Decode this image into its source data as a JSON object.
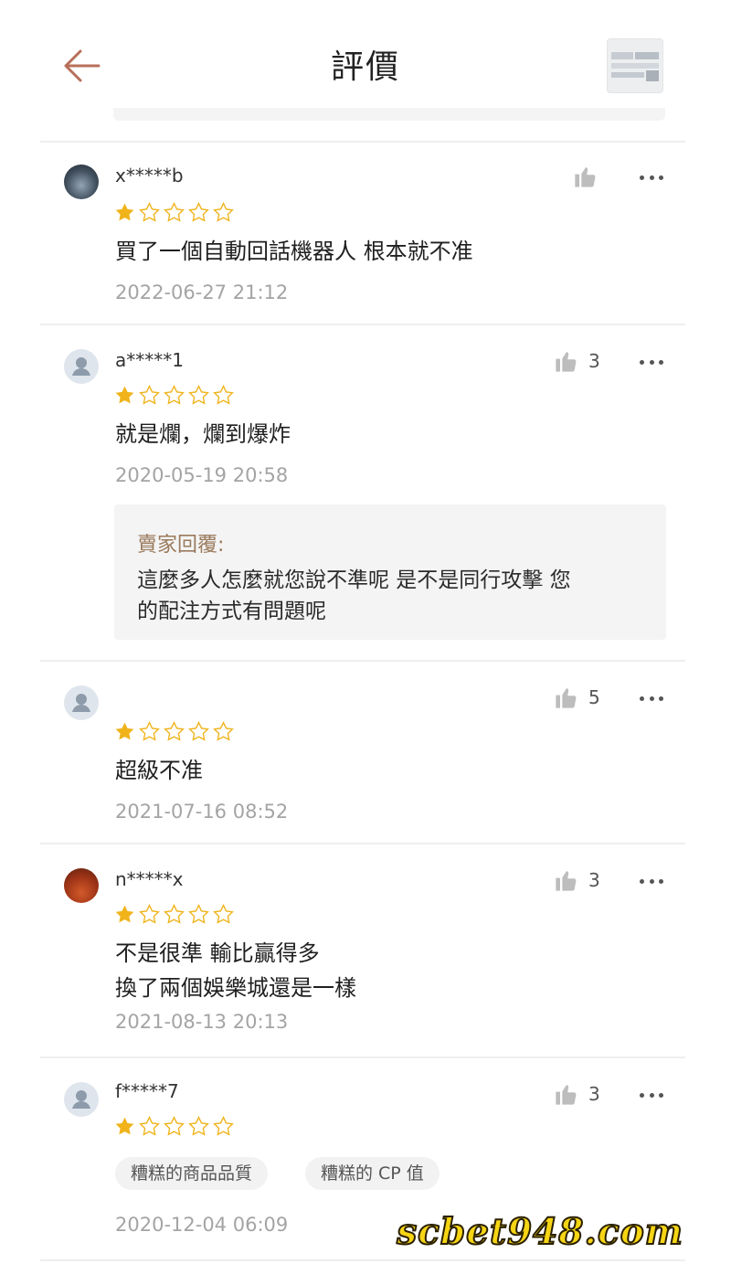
{
  "header": {
    "title": "評價",
    "back_icon": "back-arrow-icon",
    "accent_color": "#b86f5a"
  },
  "reviews": [
    {
      "username": "x*****b",
      "rating": 1,
      "max_rating": 5,
      "content": "買了一個自動回話機器人 根本就不准",
      "date": "2022-06-27 21:12",
      "likes": ""
    },
    {
      "username": "a*****1",
      "rating": 1,
      "max_rating": 5,
      "content": "就是爛，爛到爆炸",
      "date": "2020-05-19 20:58",
      "likes": "3",
      "seller_reply": {
        "label": "賣家回覆:",
        "text": "這麼多人怎麼就您說不準呢 是不是同行攻擊 您\n的配注方式有問題呢"
      }
    },
    {
      "username": "",
      "rating": 1,
      "max_rating": 5,
      "content": "超級不准",
      "date": "2021-07-16 08:52",
      "likes": "5"
    },
    {
      "username": "n*****x",
      "rating": 1,
      "max_rating": 5,
      "content": "不是很準 輸比贏得多\n換了兩個娛樂城還是一樣",
      "date": "2021-08-13 20:13",
      "likes": "3"
    },
    {
      "username": "f*****7",
      "rating": 1,
      "max_rating": 5,
      "tags": [
        "糟糕的商品品質",
        "糟糕的 CP 值"
      ],
      "date": "2020-12-04 06:09",
      "likes": "3"
    }
  ],
  "colors": {
    "star_filled": "#f0b31a",
    "star_empty": "#f0b31a",
    "date_text": "#a4a4a4",
    "reply_label": "#9a7a5c",
    "watermark": "#f6d514"
  },
  "watermark": {
    "text": "scbet948.com"
  }
}
